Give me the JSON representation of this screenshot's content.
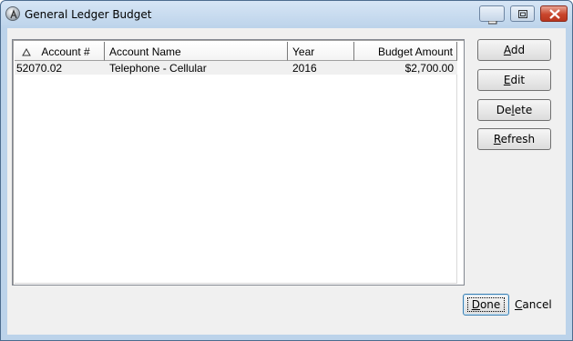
{
  "window": {
    "title": "General Ledger Budget",
    "controls": [
      "minimize-icon",
      "restore-icon",
      "close-icon"
    ]
  },
  "grid": {
    "columns": [
      {
        "label": "Account #"
      },
      {
        "label": "Account Name"
      },
      {
        "label": "Year"
      },
      {
        "label": "Budget Amount"
      }
    ],
    "rows": [
      {
        "account": "52070.02",
        "name": "Telephone - Cellular",
        "year": "2016",
        "amount": "$2,700.00"
      }
    ]
  },
  "actions": {
    "add": {
      "pre": "",
      "key": "A",
      "post": "dd"
    },
    "edit": {
      "pre": "",
      "key": "E",
      "post": "dit"
    },
    "delete": {
      "pre": "De",
      "key": "l",
      "post": "ete"
    },
    "refresh": {
      "pre": "",
      "key": "R",
      "post": "efresh"
    }
  },
  "footer": {
    "done": {
      "pre": "",
      "key": "D",
      "post": "one"
    },
    "cancel": {
      "pre": "",
      "key": "C",
      "post": "ancel"
    }
  },
  "colors": {
    "frame": "#bcd3ea",
    "client": "#f0f0f0",
    "close_button": "#c9462c"
  }
}
